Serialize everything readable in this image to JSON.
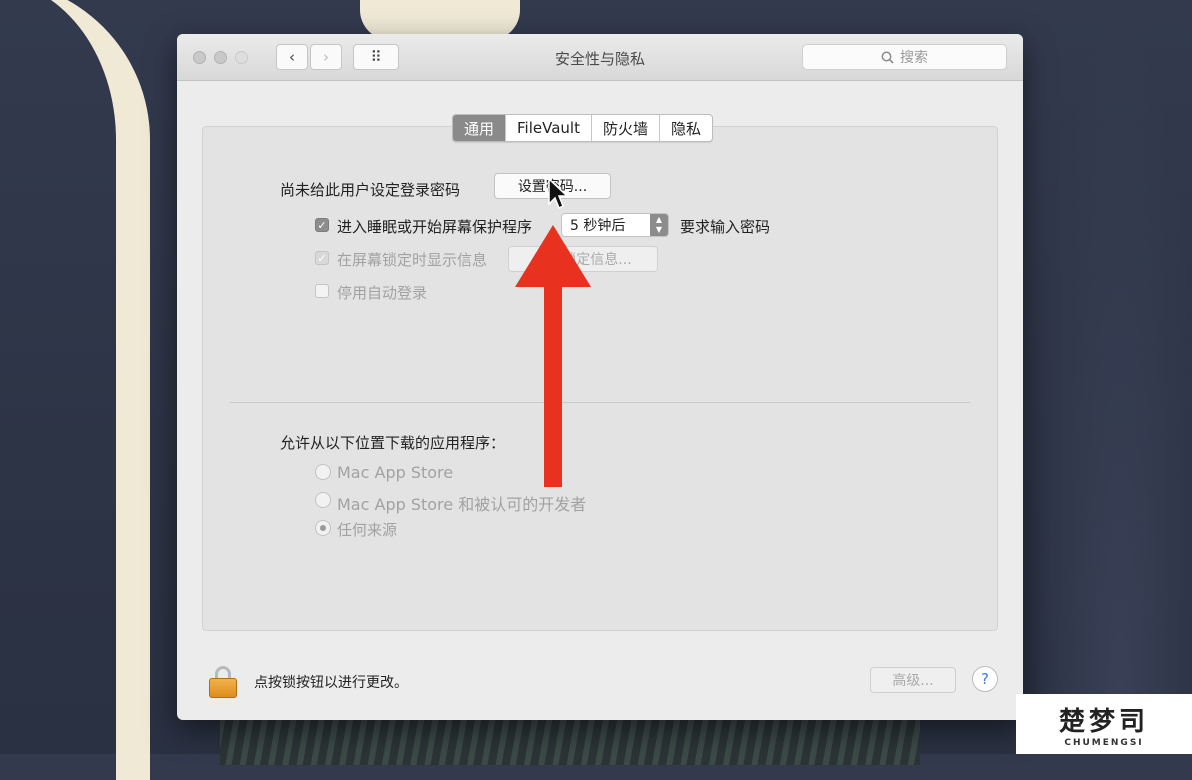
{
  "window": {
    "title": "安全性与隐私",
    "search_placeholder": "搜索",
    "nav_back": "‹",
    "nav_forward": "›",
    "grid_icon": "⠿"
  },
  "tabs": [
    {
      "label": "通用",
      "active": true
    },
    {
      "label": "FileVault",
      "active": false
    },
    {
      "label": "防火墙",
      "active": false
    },
    {
      "label": "隐私",
      "active": false
    }
  ],
  "general": {
    "no_password_text": "尚未给此用户设定登录密码",
    "set_password_button": "设置密码...",
    "require_password_checkbox": {
      "label": "进入睡眠或开始屏幕保护程序",
      "checked": true
    },
    "delay_select": {
      "value": "5 秒钟后"
    },
    "require_suffix": "要求输入密码",
    "show_message_checkbox": {
      "label": "在屏幕锁定时显示信息",
      "checked": true,
      "enabled": false
    },
    "set_lock_message_button": "设置锁定信息...",
    "disable_auto_login_checkbox": {
      "label": "停用自动登录",
      "checked": false,
      "enabled": false
    }
  },
  "downloads": {
    "heading": "允许从以下位置下载的应用程序：",
    "options": [
      {
        "label": "Mac App Store",
        "selected": false
      },
      {
        "label": "Mac App Store 和被认可的开发者",
        "selected": false
      },
      {
        "label": "任何来源",
        "selected": true
      }
    ]
  },
  "footer": {
    "lock_text": "点按锁按钮以进行更改。",
    "advanced_button": "高级...",
    "help_label": "?"
  },
  "colors": {
    "annotation_arrow": "#e8321f",
    "lock": "#e89a2a",
    "active_tab": "#8a8a8a"
  },
  "watermark": {
    "main": "楚梦司",
    "sub": "CHUMENGSI"
  }
}
